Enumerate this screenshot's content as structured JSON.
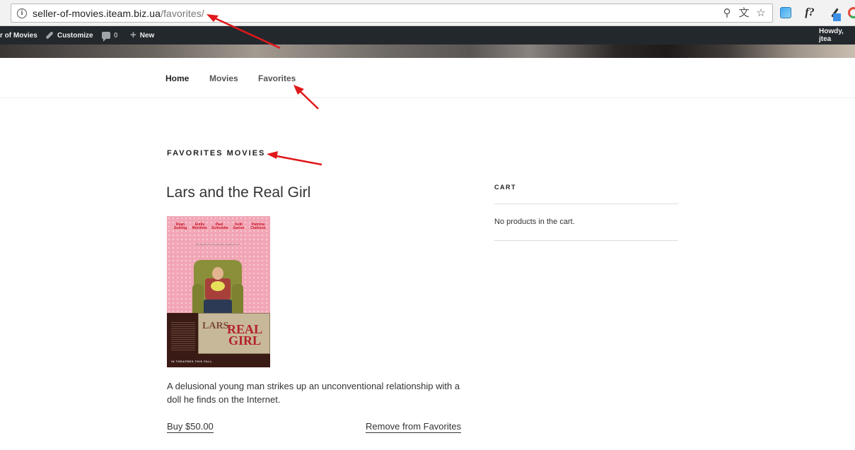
{
  "browser": {
    "url_host": "seller-of-movies.iteam.biz.ua",
    "url_path": "/favorites/",
    "extension_label": "f?"
  },
  "adminbar": {
    "site_name": "r of Movies",
    "customize": "Customize",
    "comments_count": "0",
    "new_label": "New",
    "howdy": "Howdy, jtea"
  },
  "nav": {
    "items": [
      {
        "label": "Home"
      },
      {
        "label": "Movies"
      },
      {
        "label": "Favorites"
      }
    ]
  },
  "main": {
    "page_title": "FAVORITES MOVIES",
    "movie": {
      "title": "Lars and the Real Girl",
      "description": "A delusional young man strikes up an unconventional relationship with a doll he finds on the Internet.",
      "buy_label": "Buy $50.00",
      "remove_label": "Remove from Favorites",
      "poster": {
        "cast": [
          "Ryan Gosling",
          "Emily Mortimer",
          "Paul Schneider",
          "Kelli Garner",
          "Patricia Clarkson"
        ],
        "tagline": "The search for true love begins outside the box.",
        "title_lars": "LARS",
        "title_main": "REAL GIRL",
        "footer": "IN THEATRES THIS FALL"
      }
    }
  },
  "sidebar": {
    "cart_title": "CART",
    "cart_empty": "No products in the cart."
  },
  "colors": {
    "adminbar_bg": "#23282d",
    "annotation_arrow": "#e0181b",
    "nav_active": "#222222",
    "nav_inactive": "#555555"
  }
}
